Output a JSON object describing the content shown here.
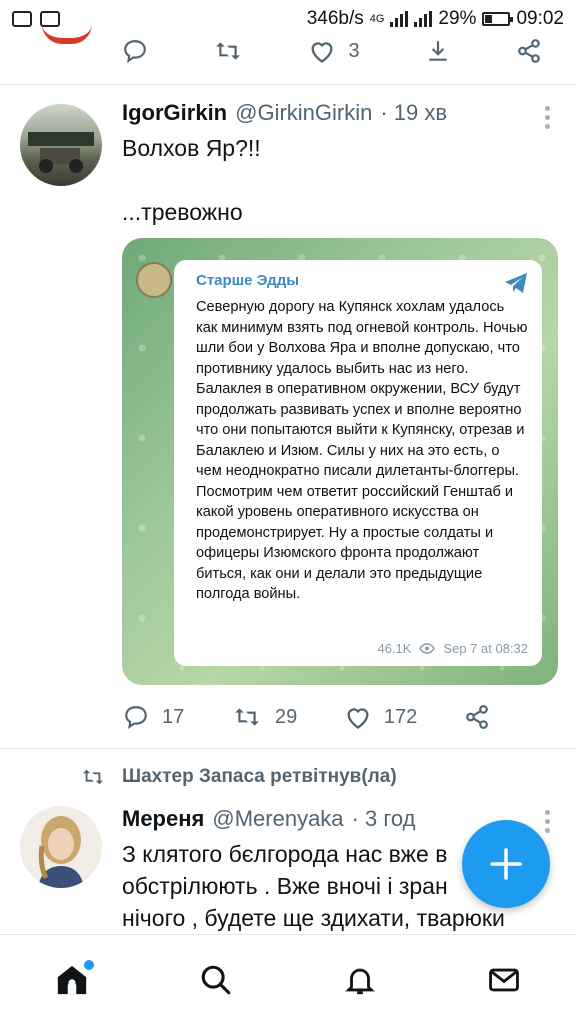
{
  "status_bar": {
    "speed": "346b/s",
    "network": "4G",
    "battery": "29%",
    "time": "09:02"
  },
  "prev_tweet": {
    "like_count": "3"
  },
  "tweet1": {
    "name": "IgorGirkin",
    "handle": "@GirkinGirkin",
    "time": "· 19 хв",
    "text": "Волхов Яр?!!\n\n...тревожно",
    "media": {
      "channel": "Старше Эдды",
      "body": "Северную дорогу на Купянск хохлам удалось как минимум взять под огневой контроль. Ночью шли бои у Волхова Яра и вполне допускаю, что противнику удалось выбить нас из него. Балаклея в оперативном окружении, ВСУ будут продолжать развивать успех и вполне вероятно что они попытаются выйти к Купянску, отрезав и Балаклею и Изюм. Силы у них на это есть, о чем неоднократно писали дилетанты-блоггеры. Посмотрим чем ответит российский Генштаб и какой уровень оперативного искусства он продемонстрирует. Ну а простые солдаты и офицеры Изюмского фронта продолжают биться, как они и делали это предыдущие полгода войны.",
      "views": "46.1K",
      "date": "Sep 7 at 08:32"
    },
    "reply_count": "17",
    "retweet_count": "29",
    "like_count": "172"
  },
  "retweet_line": "Шахтер Запаса ретвітнув(ла)",
  "tweet2": {
    "name": "Мереня",
    "handle": "@Merenyaka",
    "time": "· 3 год",
    "text": "З клятого бєлгорода нас вже в\nобстрілюють . Вже вночі і зран\nнічого , будете ще здихати, тварюки"
  },
  "colors": {
    "accent": "#1d9bf0",
    "secondary_text": "#536471",
    "telegram_blue": "#3a8bbf"
  }
}
